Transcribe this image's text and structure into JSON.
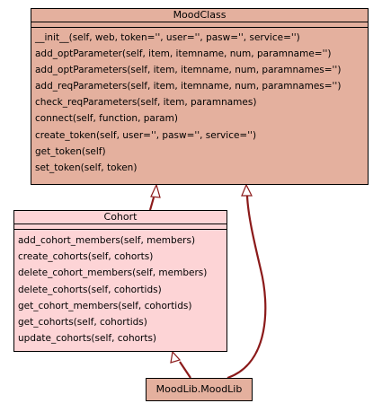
{
  "diagram": {
    "colors": {
      "base_fill": "#e4b09e",
      "cohort_fill": "#fdd4d6",
      "edge": "#8b1a1a",
      "outline": "#000000"
    },
    "classes": {
      "moodclass": {
        "name": "MoodClass",
        "methods": [
          "__init__(self, web, token='', user='', pasw='', service='')",
          "add_optParameter(self, item, itemname, num, paramname='')",
          "add_optParameters(self, item, itemname, num, paramnames='')",
          "add_reqParameters(self, item, itemname, num, paramnames='')",
          "check_reqParameters(self, item, paramnames)",
          "connect(self, function, param)",
          "create_token(self, user='', pasw='', service='')",
          "get_token(self)",
          "set_token(self, token)"
        ]
      },
      "cohort": {
        "name": "Cohort",
        "methods": [
          "add_cohort_members(self, members)",
          "create_cohorts(self, cohorts)",
          "delete_cohort_members(self, members)",
          "delete_cohorts(self, cohortids)",
          "get_cohort_members(self, cohortids)",
          "get_cohorts(self, cohortids)",
          "update_cohorts(self, cohorts)"
        ]
      },
      "moodlib": {
        "name": "MoodLib.MoodLib"
      }
    },
    "relations": [
      {
        "from": "Cohort",
        "to": "MoodClass",
        "type": "inheritance"
      },
      {
        "from": "MoodLib.MoodLib",
        "to": "Cohort",
        "type": "inheritance"
      },
      {
        "from": "MoodLib.MoodLib",
        "to": "MoodClass",
        "type": "inheritance"
      }
    ]
  }
}
